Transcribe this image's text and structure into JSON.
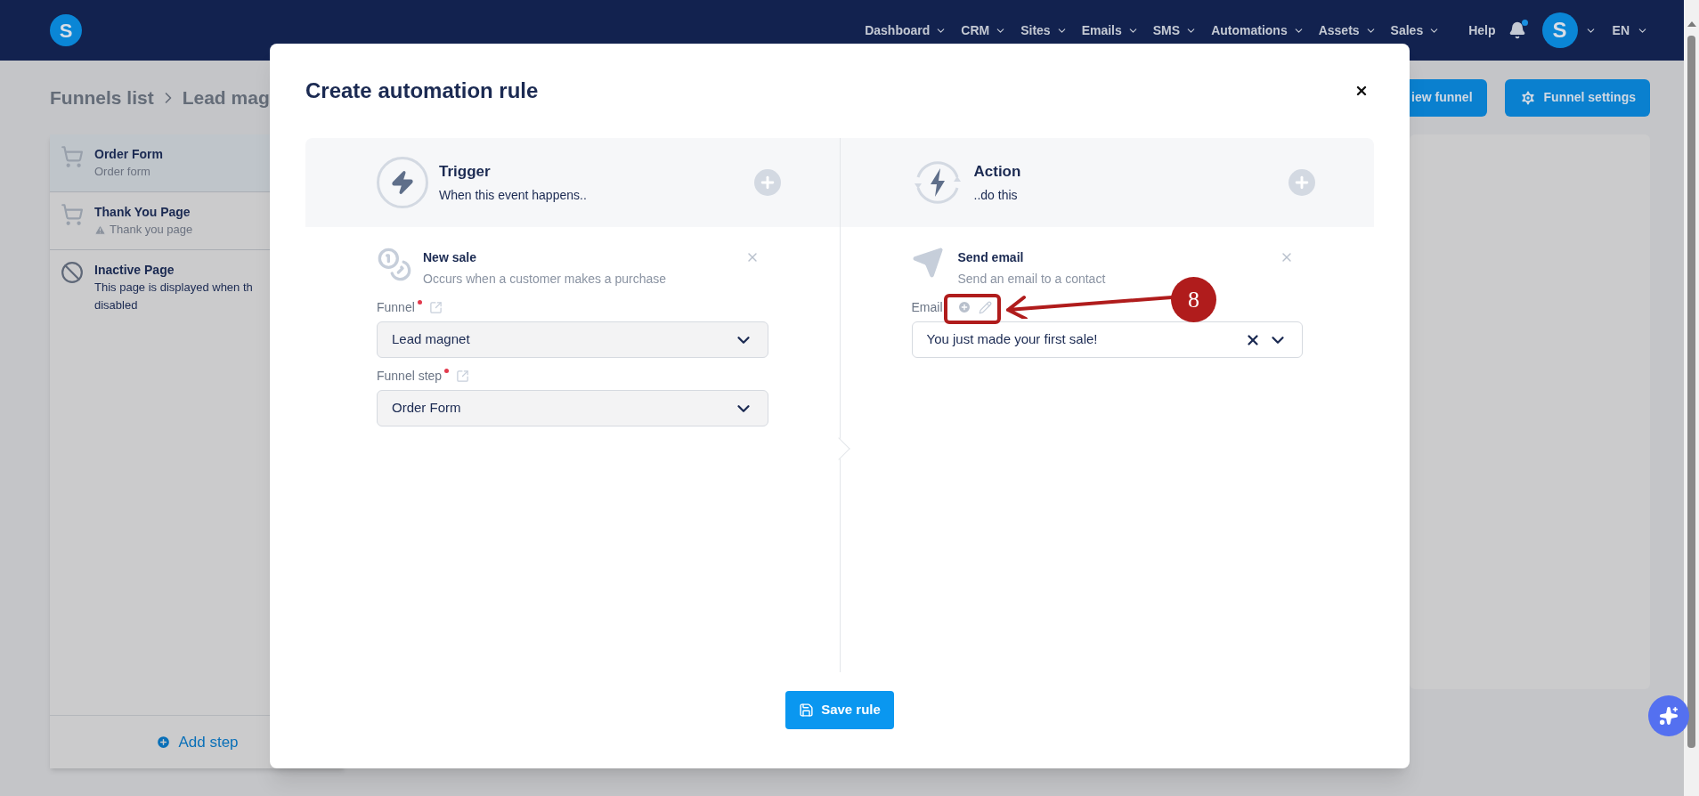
{
  "nav": {
    "logo": "S",
    "items": [
      {
        "label": "Dashboard"
      },
      {
        "label": "CRM"
      },
      {
        "label": "Sites"
      },
      {
        "label": "Emails"
      },
      {
        "label": "SMS"
      },
      {
        "label": "Automations"
      },
      {
        "label": "Assets"
      },
      {
        "label": "Sales"
      }
    ],
    "help": "Help",
    "notification": {
      "unread": true
    },
    "avatar": "S",
    "language": "EN"
  },
  "page": {
    "breadcrumb": [
      "Funnels list",
      "Lead mag"
    ],
    "buttons": [
      {
        "kind": "view",
        "label": "iew funnel"
      },
      {
        "kind": "settings",
        "label": "Funnel settings"
      }
    ],
    "steps": [
      {
        "kind": "order",
        "title": "Order Form",
        "lines": [
          "Order form"
        ],
        "warning": false,
        "selected": true
      },
      {
        "kind": "thanks",
        "title": "Thank You Page",
        "lines": [
          "Thank you page"
        ],
        "warning": true,
        "selected": false
      },
      {
        "kind": "inactive",
        "title": "Inactive Page",
        "lines": [
          "This page is displayed when th",
          "disabled"
        ],
        "warning": false,
        "selected": false
      }
    ],
    "add_step": "Add step"
  },
  "modal": {
    "title": "Create automation rule",
    "columns": [
      {
        "kind": "trigger",
        "title": "Trigger",
        "subtitle": "When this event happens..",
        "item": {
          "kind": "sale",
          "title": "New sale",
          "description": "Occurs when a customer makes a purchase"
        },
        "fields": [
          {
            "kind": "link",
            "label": "Funnel",
            "required": true,
            "value": "Lead magnet",
            "clearable": false
          },
          {
            "kind": "link",
            "label": "Funnel step",
            "required": true,
            "value": "Order Form",
            "clearable": false
          }
        ]
      },
      {
        "kind": "action",
        "title": "Action",
        "subtitle": "..do this",
        "item": {
          "kind": "email",
          "title": "Send email",
          "description": "Send an email to a contact"
        },
        "fields": [
          {
            "kind": "edit",
            "label": "Email",
            "required": false,
            "value": "You just made your first sale!",
            "clearable": true
          }
        ]
      }
    ],
    "save": "Save rule"
  },
  "annotation": {
    "label": "8"
  }
}
